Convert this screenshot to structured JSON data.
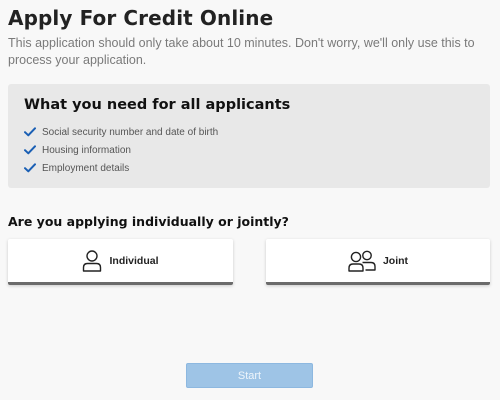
{
  "page": {
    "title": "Apply For Credit Online",
    "subtitle": "This application should only take about 10 minutes. Don't worry, we'll only use this to process your application."
  },
  "requirements": {
    "heading": "What you need for all applicants",
    "items": [
      {
        "label": "Social security number and date of birth",
        "icon": "check-icon"
      },
      {
        "label": "Housing information",
        "icon": "check-icon"
      },
      {
        "label": "Employment details",
        "icon": "check-icon"
      }
    ]
  },
  "applicant_type": {
    "question": "Are you applying individually or jointly?",
    "options": [
      {
        "label": "Individual",
        "icon": "person-icon"
      },
      {
        "label": "Joint",
        "icon": "two-people-icon"
      }
    ]
  },
  "actions": {
    "start_label": "Start"
  },
  "colors": {
    "accent_check": "#1a5fb4",
    "start_button_disabled": "#9ec4e6",
    "requirements_background": "#e8e8e8"
  }
}
